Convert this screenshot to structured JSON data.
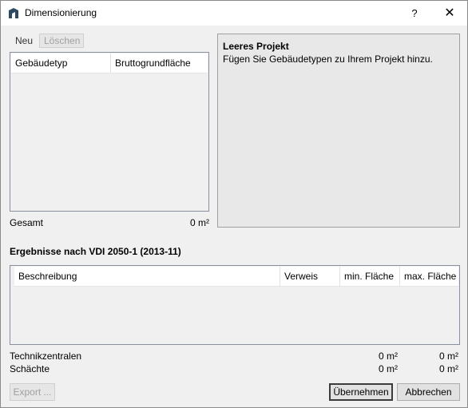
{
  "window": {
    "title": "Dimensionierung",
    "help_label": "?",
    "close_label": "✕"
  },
  "toolbar": {
    "new_label": "Neu",
    "delete_label": "Löschen"
  },
  "building_list": {
    "columns": [
      "Gebäudetyp",
      "Bruttogrundfläche"
    ],
    "rows": []
  },
  "total": {
    "label": "Gesamt",
    "value": "0 m²"
  },
  "info": {
    "title": "Leeres Projekt",
    "text": "Fügen Sie Gebäudetypen zu Ihrem Projekt hinzu."
  },
  "results": {
    "title": "Ergebnisse nach VDI 2050-1 (2013-11)",
    "columns": [
      "Beschreibung",
      "Verweis",
      "min. Fläche",
      "max. Fläche"
    ],
    "rows": []
  },
  "summary": [
    {
      "label": "Technikzentralen",
      "min": "0 m²",
      "max": "0 m²"
    },
    {
      "label": "Schächte",
      "min": "0 m²",
      "max": "0 m²"
    }
  ],
  "buttons": {
    "export": "Export ...",
    "apply": "Übernehmen",
    "cancel": "Abbrechen"
  }
}
